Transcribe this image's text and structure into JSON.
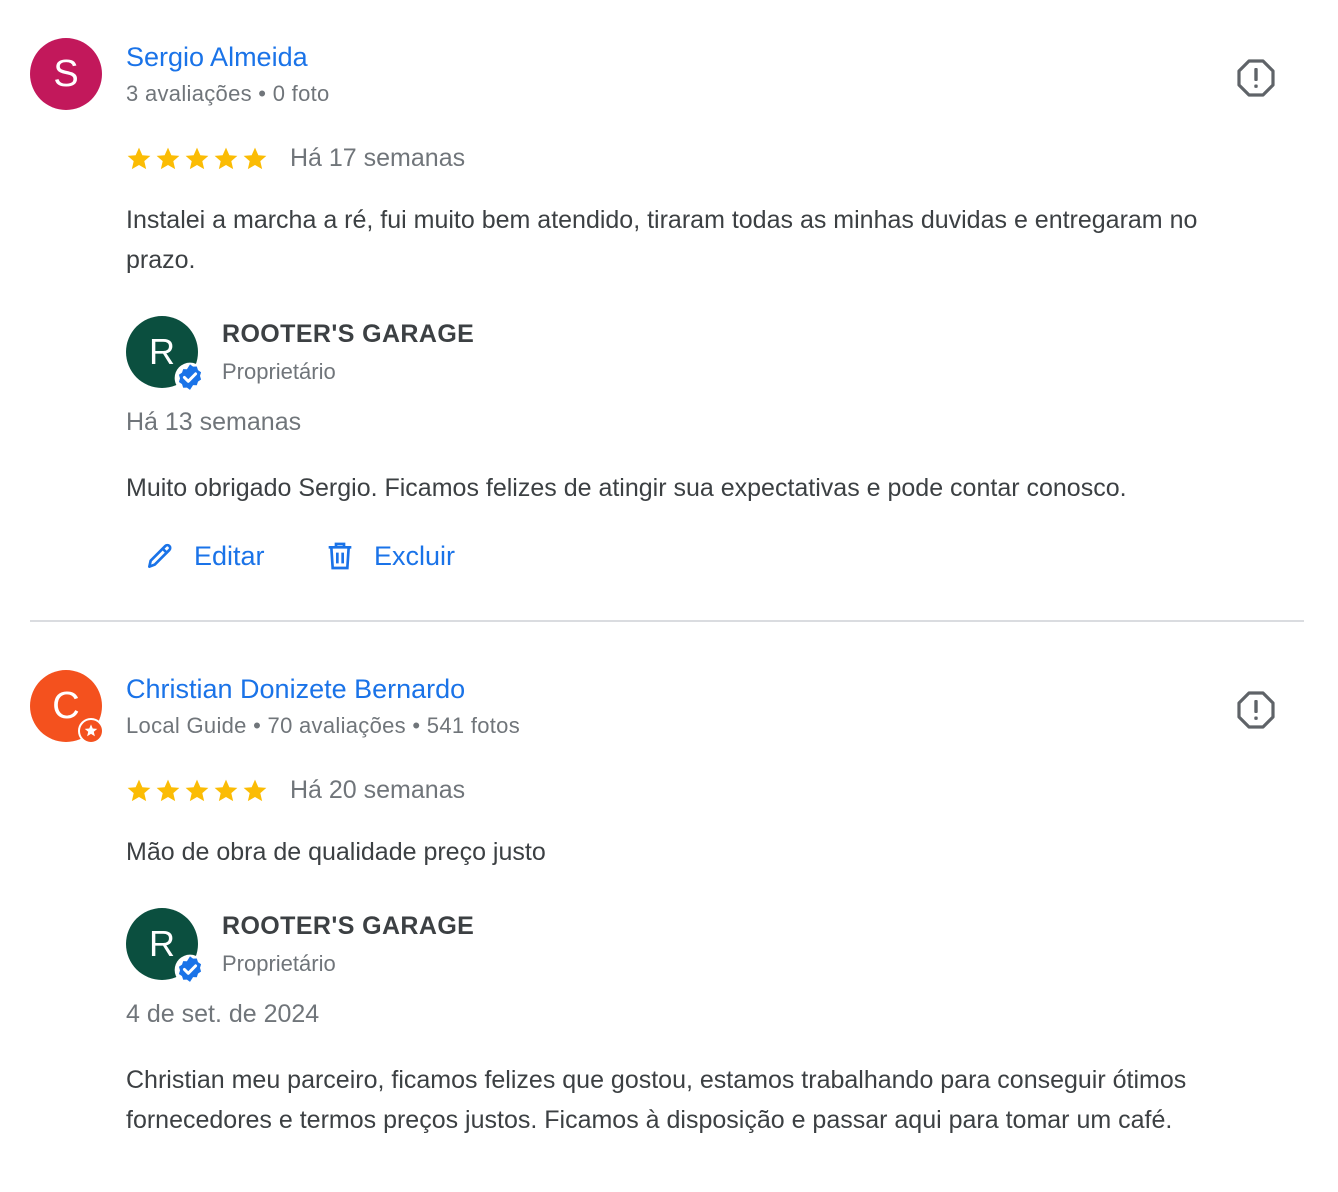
{
  "colors": {
    "accent": "#1a73e8",
    "star": "#fbbc04",
    "owner_avatar": "#0b4f3f"
  },
  "reviews": [
    {
      "avatar_letter": "S",
      "avatar_color": "#c2185b",
      "author": "Sergio Almeida",
      "meta": "3 avaliações • 0 foto",
      "rating": 5,
      "date": "Há 17 semanas",
      "text": "Instalei a marcha a ré, fui muito bem atendido, tiraram todas as minhas duvidas e entregaram no prazo.",
      "reply": {
        "avatar_letter": "R",
        "owner_name": "ROOTER'S GARAGE",
        "owner_role": "Proprietário",
        "date": "Há 13 semanas",
        "text": "Muito obrigado Sergio. Ficamos felizes de atingir sua expectativas e pode contar conosco."
      },
      "actions": {
        "edit_label": "Editar",
        "delete_label": "Excluir"
      }
    },
    {
      "avatar_letter": "C",
      "avatar_color": "#f4511e",
      "author": "Christian Donizete Bernardo",
      "meta": "Local Guide • 70 avaliações • 541 fotos",
      "rating": 5,
      "date": "Há 20 semanas",
      "text": "Mão de obra de qualidade preço justo",
      "reply": {
        "avatar_letter": "R",
        "owner_name": "ROOTER'S GARAGE",
        "owner_role": "Proprietário",
        "date": "4 de set. de 2024",
        "text": "Christian meu parceiro, ficamos felizes que gostou, estamos trabalhando para conseguir ótimos fornecedores e termos preços justos. Ficamos à disposição e passar aqui para tomar um café."
      }
    }
  ]
}
